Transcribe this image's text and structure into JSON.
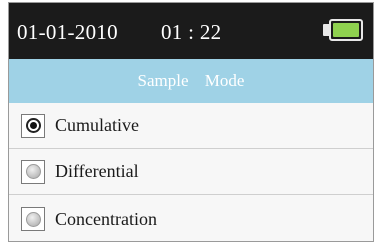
{
  "status_bar": {
    "date": "01-01-2010",
    "time": "01 : 22",
    "battery_icon": "battery-icon",
    "battery_level": 1.0,
    "battery_color": "#8fd14f",
    "background_color": "#1b1b1b"
  },
  "header": {
    "title": "Sample   Mode",
    "background_color": "#9fd2e6"
  },
  "options": [
    {
      "label": "Cumulative",
      "selected": true
    },
    {
      "label": "Differential",
      "selected": false
    },
    {
      "label": "Concentration",
      "selected": false
    }
  ]
}
